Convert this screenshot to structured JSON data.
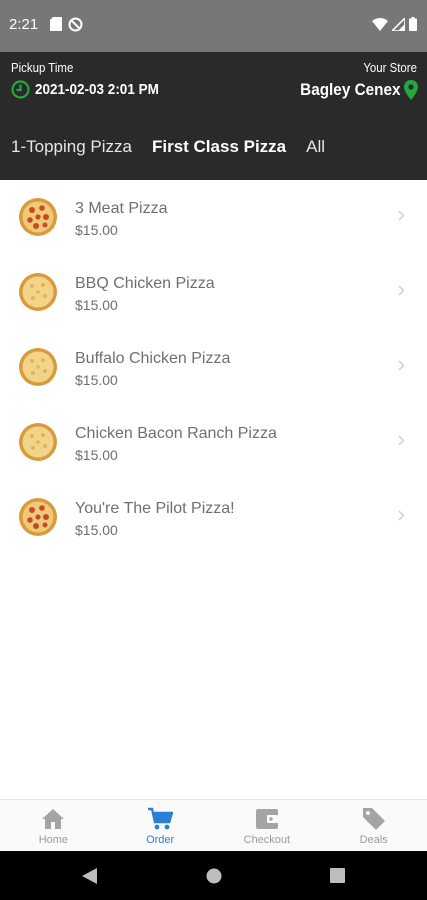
{
  "status_bar": {
    "time": "2:21"
  },
  "header": {
    "pickup_label": "Pickup Time",
    "pickup_value": "2021-02-03 2:01 PM",
    "store_label": "Your Store",
    "store_value": "Bagley Cenex",
    "accent_color": "#22a83c"
  },
  "tabs": [
    {
      "label": "1-Topping Pizza",
      "active": false
    },
    {
      "label": "First Class Pizza",
      "active": true
    },
    {
      "label": "All",
      "active": false
    }
  ],
  "items": [
    {
      "name": "3 Meat Pizza",
      "price": "$15.00",
      "icon": "pepperoni-pizza-icon"
    },
    {
      "name": "BBQ Chicken Pizza",
      "price": "$15.00",
      "icon": "cheese-pizza-icon"
    },
    {
      "name": "Buffalo Chicken Pizza",
      "price": "$15.00",
      "icon": "cheese-pizza-icon"
    },
    {
      "name": "Chicken Bacon Ranch Pizza",
      "price": "$15.00",
      "icon": "cheese-pizza-icon"
    },
    {
      "name": "You're The Pilot Pizza!",
      "price": "$15.00",
      "icon": "pepperoni-pizza-icon"
    }
  ],
  "bottom_nav": [
    {
      "label": "Home",
      "icon": "home-icon",
      "active": false
    },
    {
      "label": "Order",
      "icon": "cart-icon",
      "active": true
    },
    {
      "label": "Checkout",
      "icon": "wallet-icon",
      "active": false
    },
    {
      "label": "Deals",
      "icon": "tags-icon",
      "active": false
    }
  ],
  "colors": {
    "active_nav": "#2d7fd3",
    "header_bg": "#2a2a2a"
  }
}
